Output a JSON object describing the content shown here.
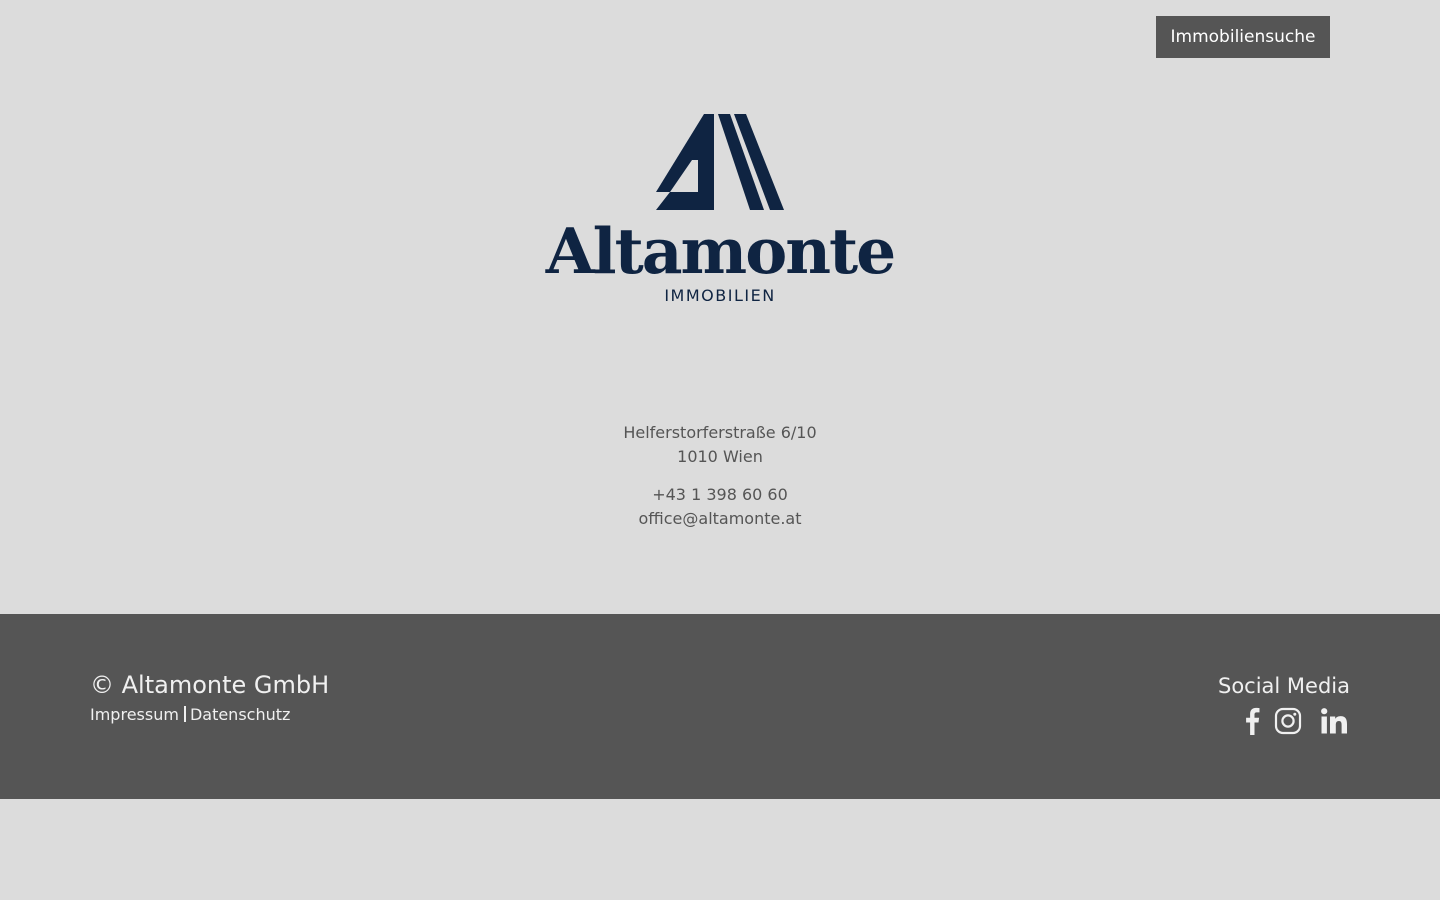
{
  "header": {
    "search_button": "Immobiliensuche"
  },
  "logo": {
    "wordmark": "Altamonte",
    "subtitle": "IMMOBILIEN",
    "color": "#0f2442"
  },
  "contact": {
    "street": "Helferstorferstraße 6/10",
    "city": "1010 Wien",
    "phone": "+43 1 398 60 60",
    "email": "office@altamonte.at"
  },
  "footer": {
    "copyright": "© Altamonte GmbH",
    "links": {
      "impressum": "Impressum",
      "datenschutz": "Datenschutz"
    },
    "social_title": "Social Media",
    "social_icons": [
      "facebook-icon",
      "instagram-icon",
      "linkedin-icon"
    ],
    "background": "#555555"
  },
  "colors": {
    "page_background": "#dcdcdc",
    "button_background": "#555555",
    "text_gray": "#555555"
  }
}
